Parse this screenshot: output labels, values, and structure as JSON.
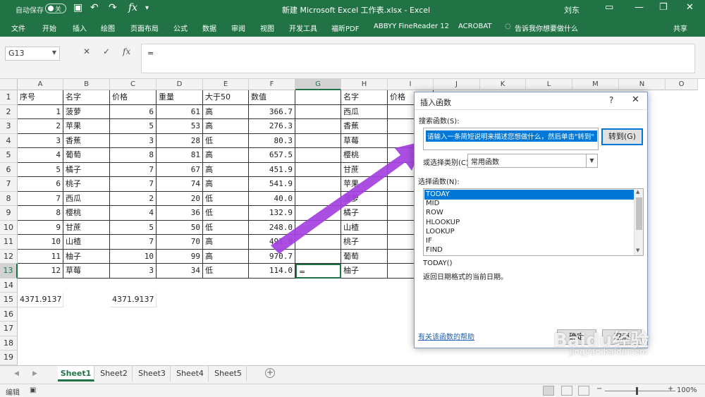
{
  "titlebar": {
    "autosave_label": "自动保存",
    "autosave_state": "关",
    "title": "新建 Microsoft Excel 工作表.xlsx - Excel",
    "user": "刘东",
    "minimize": "—",
    "restore": "❐",
    "close": "✕"
  },
  "quick_access": {
    "save": "💾",
    "undo": "↶",
    "redo": "↷",
    "fx": "fx"
  },
  "ribbon": {
    "tabs": [
      "文件",
      "开始",
      "插入",
      "绘图",
      "页面布局",
      "公式",
      "数据",
      "审阅",
      "视图",
      "开发工具",
      "福昕PDF",
      "ABBYY FineReader 12",
      "ACROBAT",
      "告诉我你想要做什么"
    ],
    "share": "共享"
  },
  "formula_bar": {
    "name_box": "G13",
    "cancel": "✕",
    "enter": "✓",
    "fx": "fx",
    "value": "="
  },
  "columns": [
    "A",
    "B",
    "C",
    "D",
    "E",
    "F",
    "G",
    "H",
    "I",
    "J",
    "K",
    "L",
    "M",
    "N",
    "O"
  ],
  "rows": [
    "1",
    "2",
    "3",
    "4",
    "5",
    "6",
    "7",
    "8",
    "9",
    "10",
    "11",
    "12",
    "13",
    "14",
    "15",
    "16",
    "17",
    "18",
    "19"
  ],
  "table": {
    "headers": [
      "序号",
      "名字",
      "价格",
      "重量",
      "大于50",
      "数值"
    ],
    "data": [
      [
        "1",
        "菠萝",
        "6",
        "61",
        "高",
        "366.7"
      ],
      [
        "2",
        "苹果",
        "5",
        "53",
        "高",
        "276.3"
      ],
      [
        "3",
        "香蕉",
        "3",
        "28",
        "低",
        "80.3"
      ],
      [
        "4",
        "葡萄",
        "8",
        "81",
        "高",
        "657.5"
      ],
      [
        "5",
        "橘子",
        "7",
        "67",
        "高",
        "451.9"
      ],
      [
        "6",
        "桃子",
        "7",
        "74",
        "高",
        "541.9"
      ],
      [
        "7",
        "西瓜",
        "2",
        "20",
        "低",
        "40.0"
      ],
      [
        "8",
        "樱桃",
        "4",
        "36",
        "低",
        "132.9"
      ],
      [
        "9",
        "甘蔗",
        "5",
        "50",
        "低",
        "248.0"
      ],
      [
        "10",
        "山楂",
        "7",
        "70",
        "高",
        "491.9"
      ],
      [
        "11",
        "柚子",
        "10",
        "99",
        "高",
        "970.7"
      ],
      [
        "12",
        "草莓",
        "3",
        "34",
        "低",
        "114.0"
      ]
    ],
    "g13": "=",
    "sum_a": "4371.9137",
    "sum_c": "4371.9137"
  },
  "table2": {
    "headers": [
      "名字",
      "价格"
    ],
    "names": [
      "西瓜",
      "香蕉",
      "草莓",
      "樱桃",
      "甘蔗",
      "苹果",
      "菠萝",
      "橘子",
      "山楂",
      "桃子",
      "葡萄",
      "柚子"
    ]
  },
  "sheets": {
    "tabs": [
      "Sheet1",
      "Sheet2",
      "Sheet3",
      "Sheet4",
      "Sheet5"
    ],
    "active": "Sheet1",
    "add": "+",
    "nav_prev": "◀",
    "nav_next": "▶"
  },
  "status": {
    "mode": "编辑",
    "zoom": "100%"
  },
  "dialog": {
    "title": "插入函数",
    "help": "?",
    "close": "✕",
    "search_label": "搜索函数(S):",
    "search_value": "请输入一条简短说明来描述您想做什么，然后单击\"转到\"",
    "go_button": "转到(G)",
    "category_label": "或选择类别(C):",
    "category_value": "常用函数",
    "function_label": "选择函数(N):",
    "functions": [
      "TODAY",
      "MID",
      "ROW",
      "HLOOKUP",
      "LOOKUP",
      "IF",
      "FIND"
    ],
    "selected": "TODAY",
    "signature": "TODAY()",
    "description": "返回日期格式的当前日期。",
    "help_link": "有关该函数的帮助",
    "ok": "确定",
    "cancel": "取消"
  },
  "watermark": {
    "logo": "Baidu经验",
    "url": "jingyan.baidu.com"
  },
  "colors": {
    "excel_green": "#217346",
    "arrow": "#a43fe0",
    "selection_blue": "#0078d7"
  }
}
